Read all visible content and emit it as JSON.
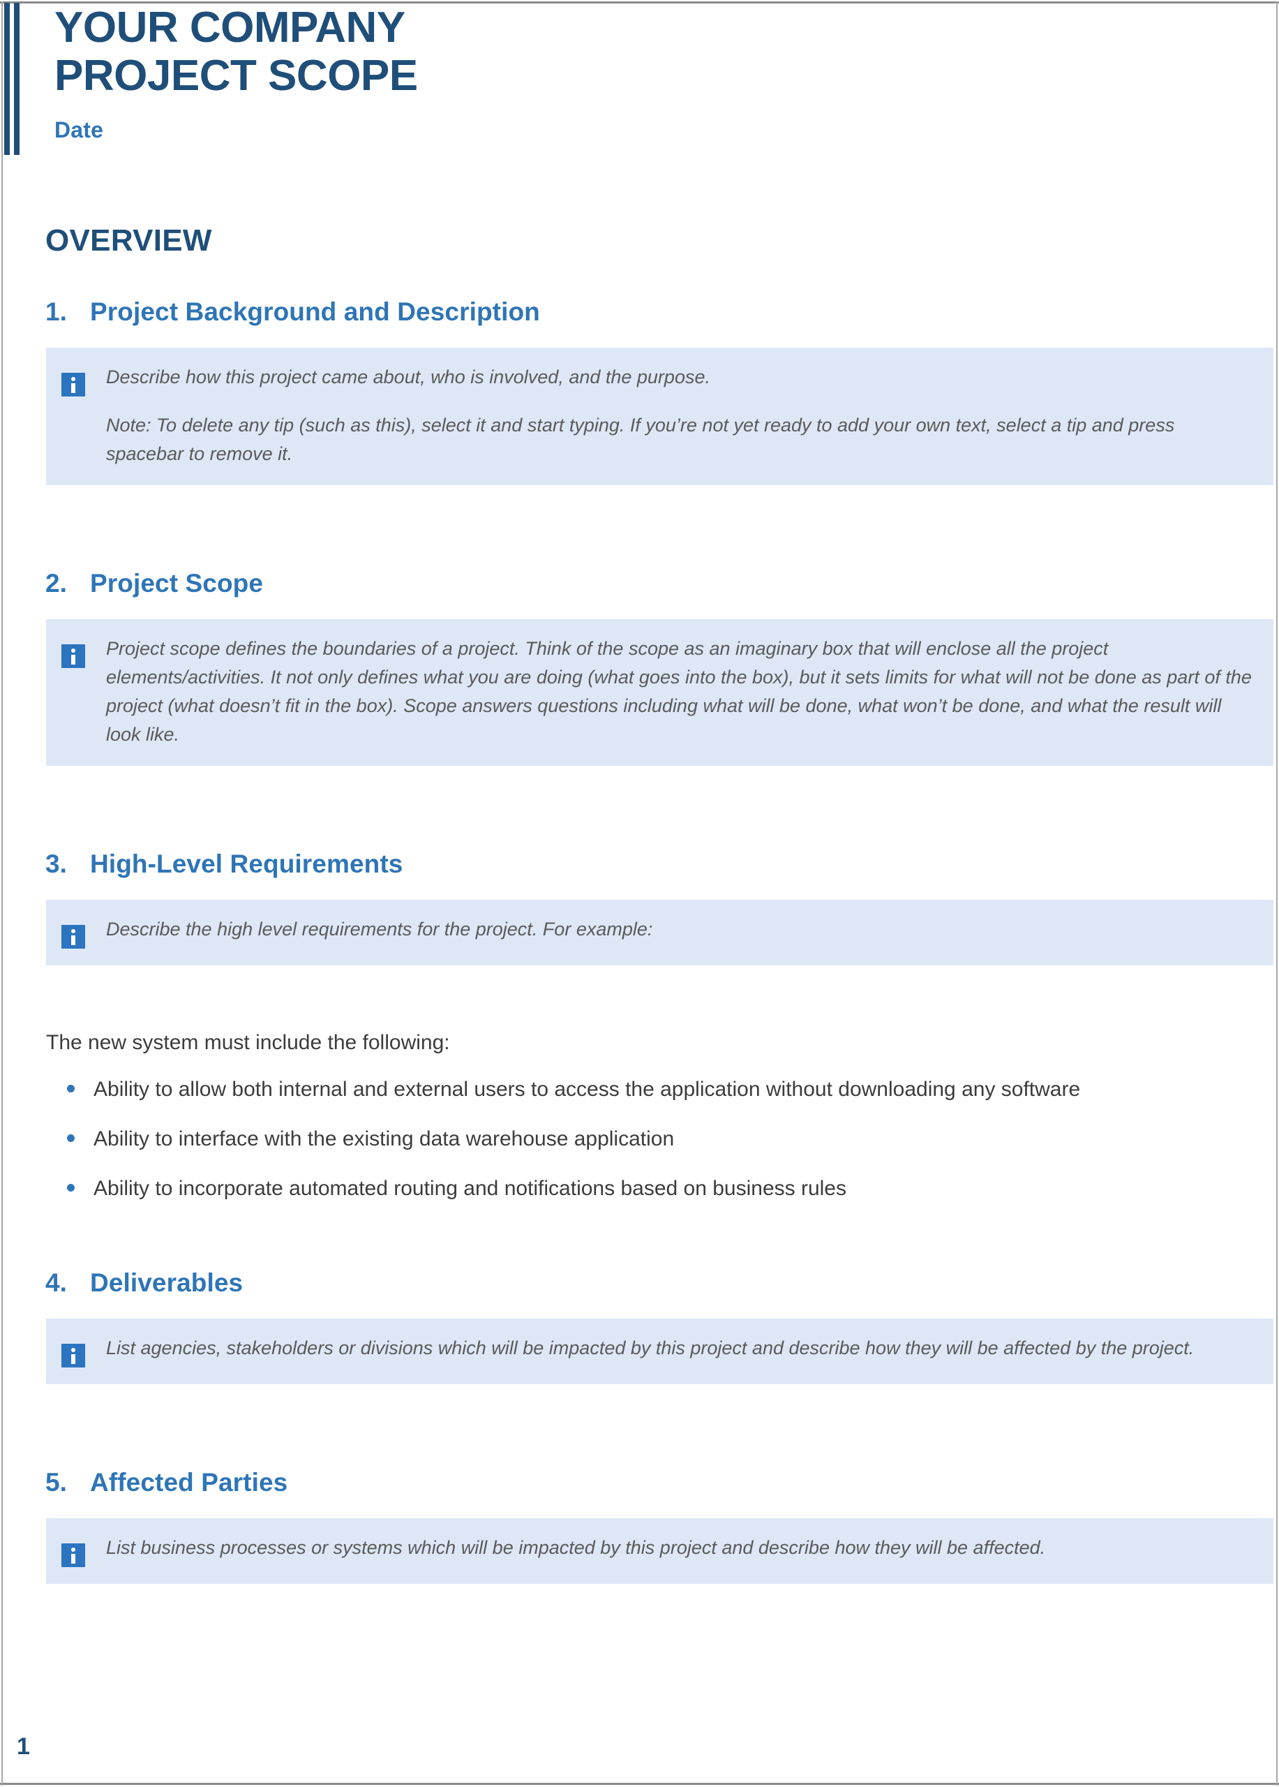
{
  "document": {
    "title_line_1": "YOUR COMPANY",
    "title_line_2": "PROJECT SCOPE",
    "date_label": "Date",
    "overview_heading": "OVERVIEW",
    "page_number": "1"
  },
  "colors": {
    "title_navy": "#1F4E79",
    "heading_blue": "#2E75B6",
    "tip_background": "#DEE7F6",
    "tip_icon_blue": "#2B74C0",
    "tip_text_gray": "#5A5A5A",
    "body_text": "#3C3C3C",
    "page_border_gray": "#8A8A8A"
  },
  "icons": {
    "tip": "info-icon"
  },
  "sections": [
    {
      "number": "1.",
      "title": "Project Background and Description",
      "tip": {
        "paragraph_1": "Describe how this project came about, who is involved, and the purpose.",
        "paragraph_2": "Note: To delete any tip (such as this), select it and start typing. If you’re not yet ready to add your own text, select a tip and press spacebar to remove it."
      }
    },
    {
      "number": "2.",
      "title": "Project Scope",
      "tip": {
        "paragraph_1": "Project scope defines the boundaries of a project. Think of the scope as an imaginary box that will enclose all the project elements/activities. It not only defines what you are doing (what goes into the box), but it sets limits for what will not be done as part of the project (what doesn’t fit in the box). Scope answers questions including what will be done, what won’t be done, and what the result will look like."
      }
    },
    {
      "number": "3.",
      "title": "High-Level Requirements",
      "tip": {
        "paragraph_1": "Describe the high level requirements for the project. For example:"
      },
      "body": {
        "intro": "The new system must include the following:",
        "bullets": [
          "Ability to allow both internal and external users to access the application without downloading any software",
          "Ability to interface with the existing data warehouse application",
          "Ability to incorporate automated routing and notifications based on business rules"
        ]
      }
    },
    {
      "number": "4.",
      "title": "Deliverables",
      "tip": {
        "paragraph_1": "List agencies, stakeholders or divisions which will be impacted by this project and describe how they will be affected by the project."
      }
    },
    {
      "number": "5.",
      "title": "Affected Parties",
      "tip": {
        "paragraph_1": "List business processes or systems which will be impacted by this project and describe how they will be affected."
      }
    }
  ]
}
